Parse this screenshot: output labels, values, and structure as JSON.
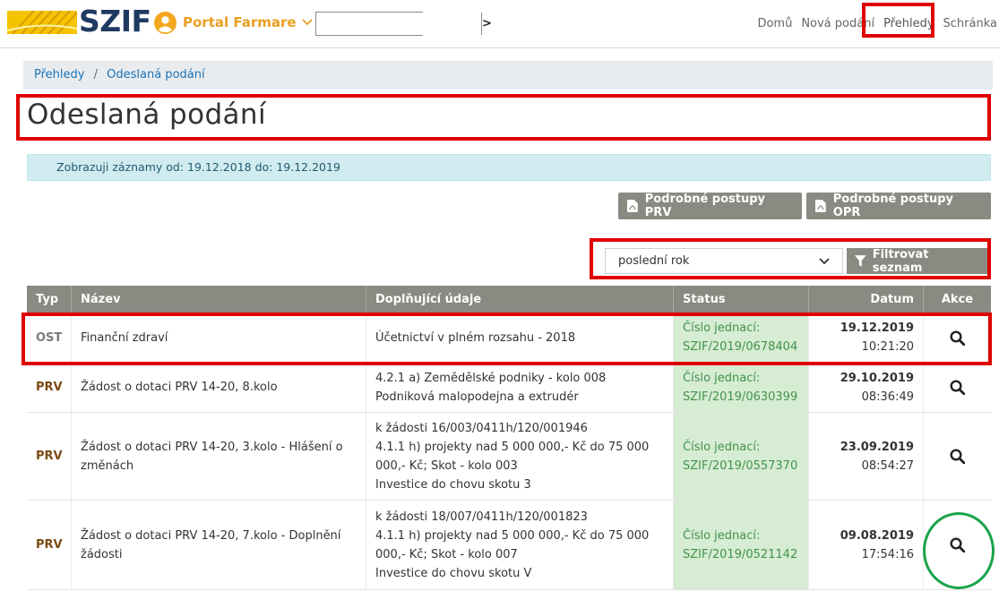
{
  "header": {
    "logo_text": "SZIF",
    "portal_label": "Portal Farmare",
    "search_value": "",
    "search_go": ">",
    "nav": [
      "Domů",
      "Nová podání",
      "Přehledy",
      "Schránka"
    ]
  },
  "breadcrumb": [
    "Přehledy",
    "Odeslaná podání"
  ],
  "breadcrumb_sep": "/",
  "page_title": "Odeslaná podání",
  "info_text": "Zobrazuji záznamy od: 19.12.2018 do: 19.12.2019",
  "buttons": {
    "prv": "Podrobné postupy PRV",
    "opr": "Podrobné postupy OPR",
    "filter": "Filtrovat seznam"
  },
  "filter": {
    "period": "poslední rok"
  },
  "table": {
    "headers": [
      "Typ",
      "Název",
      "Doplňující údaje",
      "Status",
      "Datum",
      "Akce"
    ],
    "rows": [
      {
        "typ": "OST",
        "nazev": "Finanční zdraví",
        "doplnujici": [
          "Účetnictví v plném rozsahu - 2018"
        ],
        "status_label": "Číslo jednací:",
        "status_value": "SZIF/2019/0678404",
        "date": "19.12.2019",
        "time": "10:21:20"
      },
      {
        "typ": "PRV",
        "nazev": "Žádost o dotaci PRV 14-20, 8.kolo",
        "doplnujici": [
          "4.2.1 a) Zemědělské podniky - kolo 008",
          "Podniková malopodejna a extrudér"
        ],
        "status_label": "Číslo jednací:",
        "status_value": "SZIF/2019/0630399",
        "date": "29.10.2019",
        "time": "08:36:49"
      },
      {
        "typ": "PRV",
        "nazev": "Žádost o dotaci PRV 14-20, 3.kolo - Hlášení o změnách",
        "doplnujici": [
          "k žádosti 16/003/0411h/120/001946",
          "4.1.1 h) projekty nad 5 000 000,- Kč do 75 000 000,- Kč; Skot - kolo 003",
          "Investice do chovu skotu 3"
        ],
        "status_label": "Číslo jednací:",
        "status_value": "SZIF/2019/0557370",
        "date": "23.09.2019",
        "time": "08:54:27"
      },
      {
        "typ": "PRV",
        "nazev": "Žádost o dotaci PRV 14-20, 7.kolo - Doplnění žádosti",
        "doplnujici": [
          "k žádosti 18/007/0411h/120/001823",
          "4.1.1 h) projekty nad 5 000 000,- Kč do 75 000 000,- Kč; Skot - kolo 007",
          "Investice do chovu skotu V"
        ],
        "status_label": "Číslo jednací:",
        "status_value": "SZIF/2019/0521142",
        "date": "09.08.2019",
        "time": "17:54:16"
      }
    ]
  },
  "colors": {
    "brand_navy": "#1f3a60",
    "brand_yellow": "#f4c400",
    "portal_orange": "#e8a021",
    "table_header": "#8a8a83",
    "status_bg": "#d6ecd3",
    "status_text": "#43934b",
    "highlight_red": "#e00000",
    "highlight_green": "#1aa34a"
  }
}
